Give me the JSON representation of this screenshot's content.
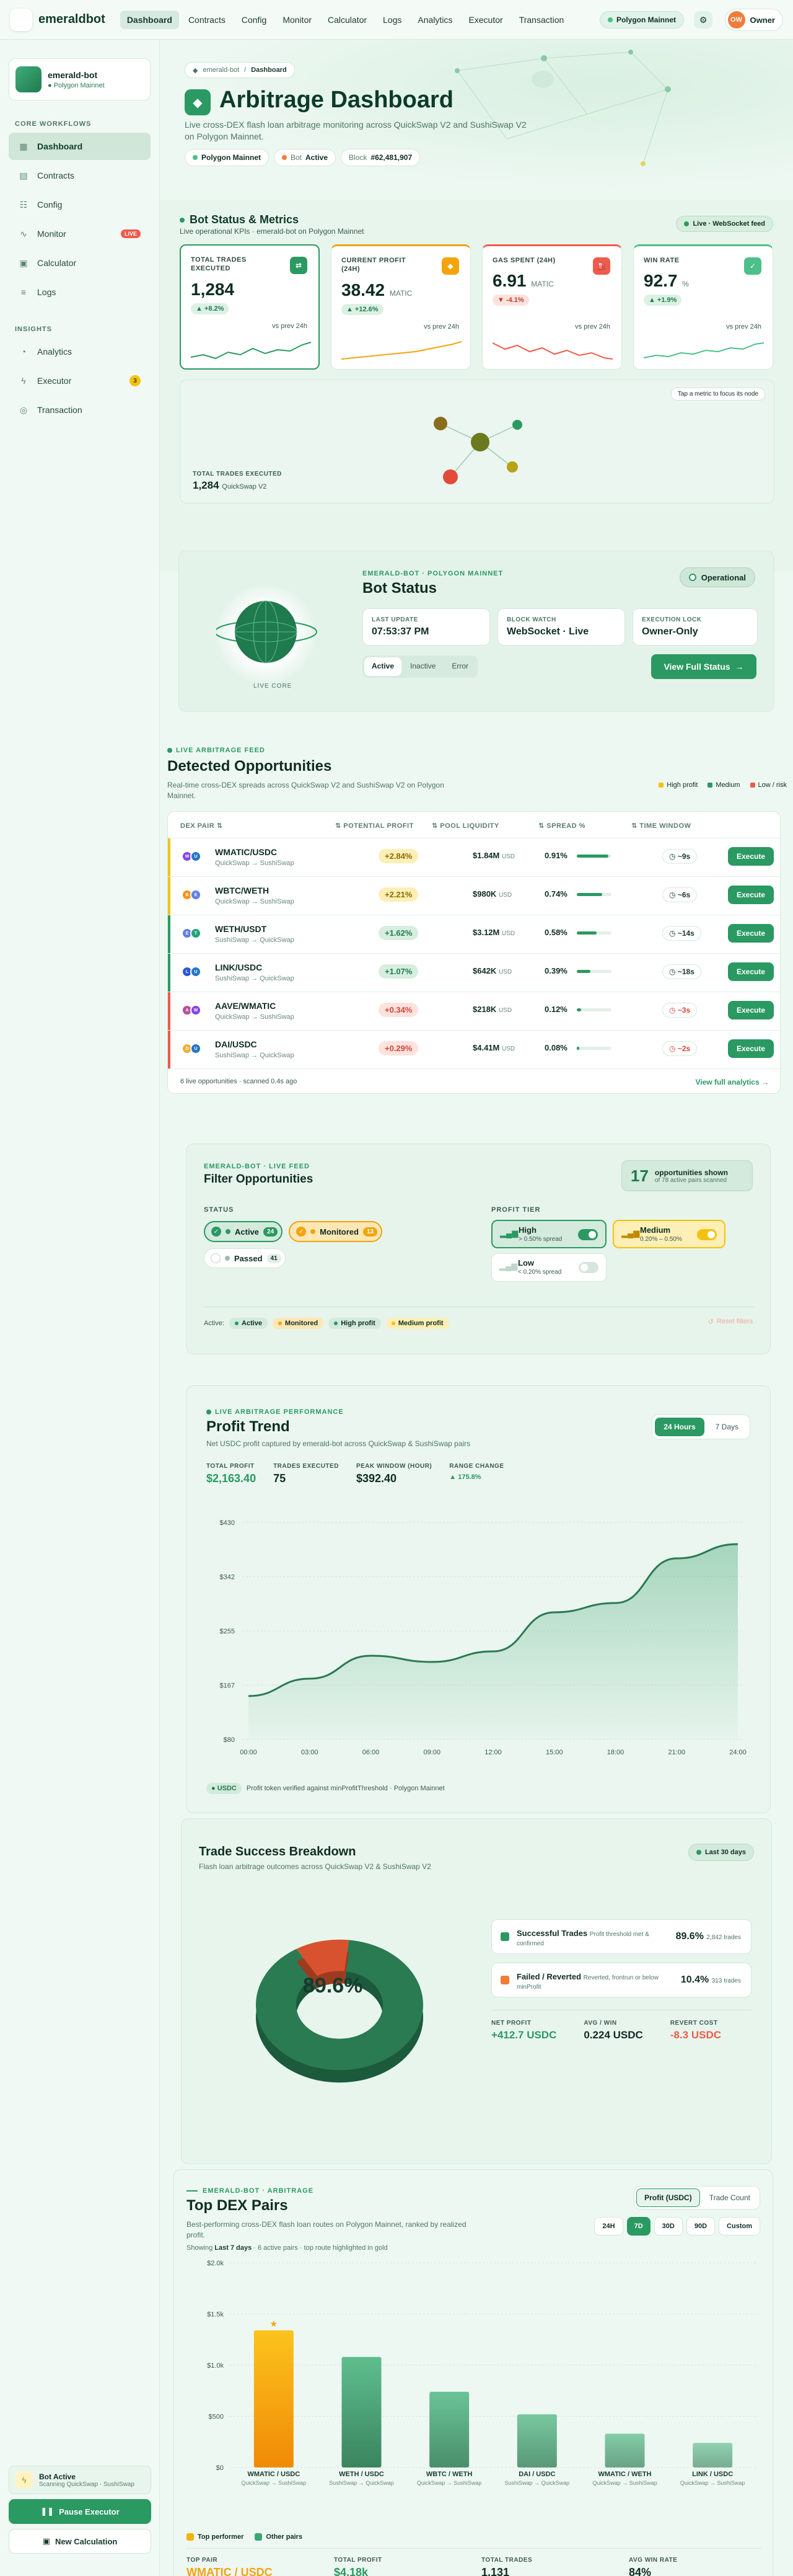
{
  "nav": {
    "brand": "emeraldbot",
    "links": [
      "Dashboard",
      "Contracts",
      "Config",
      "Monitor",
      "Calculator",
      "Logs",
      "Analytics",
      "Executor",
      "Transaction"
    ],
    "network": "Polygon Mainnet",
    "user": "Owner",
    "user_initials": "OW"
  },
  "sidebar": {
    "bot_name": "emerald-bot",
    "bot_network": "Polygon Mainnet",
    "section_core": "CORE WORKFLOWS",
    "section_insights": "INSIGHTS",
    "items": [
      {
        "label": "Dashboard",
        "icon": "grid-icon"
      },
      {
        "label": "Contracts",
        "icon": "file-icon"
      },
      {
        "label": "Config",
        "icon": "sliders-icon"
      },
      {
        "label": "Monitor",
        "icon": "activity-icon",
        "badge": "LIVE"
      },
      {
        "label": "Calculator",
        "icon": "calculator-icon"
      },
      {
        "label": "Logs",
        "icon": "list-icon"
      },
      {
        "label": "Analytics",
        "icon": "chart-icon"
      },
      {
        "label": "Executor",
        "icon": "lightning-icon",
        "badge": "3"
      },
      {
        "label": "Transaction",
        "icon": "circle-icon"
      }
    ],
    "status_title": "Bot Active",
    "status_sub": "Scanning QuickSwap · SushiSwap",
    "pause_label": "Pause Executor",
    "new_calc_label": "New Calculation"
  },
  "hero": {
    "crumb_root": "emerald-bot",
    "crumb_current": "Dashboard",
    "title": "Arbitrage Dashboard",
    "subtitle": "Live cross-DEX flash loan arbitrage monitoring across QuickSwap V2 and SushiSwap V2 on Polygon Mainnet.",
    "pill_network": "Polygon Mainnet",
    "pill_bot_label": "Bot",
    "pill_bot_value": "Active",
    "pill_block_label": "Block",
    "pill_block_value": "#62,481,907"
  },
  "metrics": {
    "title": "Bot Status & Metrics",
    "subtitle": "Live operational KPIs · emerald-bot on Polygon Mainnet",
    "live_badge": "Live · WebSocket feed",
    "cards": [
      {
        "label": "TOTAL TRADES EXECUTED",
        "value": "1,284",
        "unit": "",
        "delta": "+8.2%",
        "prev": "vs prev 24h",
        "icon": "⇄",
        "color": "#2a9962"
      },
      {
        "label": "CURRENT PROFIT (24H)",
        "value": "38.42",
        "unit": "MATIC",
        "delta": "+12.6%",
        "prev": "vs prev 24h",
        "icon": "◆",
        "color": "#f4a30d"
      },
      {
        "label": "GAS SPENT (24H)",
        "value": "6.91",
        "unit": "MATIC",
        "delta": "-4.1%",
        "prev": "vs prev 24h",
        "icon": "⛽",
        "color": "#f05a4a"
      },
      {
        "label": "WIN RATE",
        "value": "92.7",
        "unit": "%",
        "delta": "+1.9%",
        "prev": "vs prev 24h",
        "icon": "✓",
        "color": "#4cbf8a"
      }
    ],
    "network_hint": "Tap a metric to focus its node",
    "network_label": "TOTAL TRADES EXECUTED",
    "network_value": "1,284",
    "network_sub": "QuickSwap V2"
  },
  "bot_status": {
    "eyebrow": "EMERALD-BOT · POLYGON MAINNET",
    "title": "Bot Status",
    "state": "Operational",
    "globe_label": "LIVE CORE",
    "boxes": [
      {
        "label": "LAST UPDATE",
        "value": "07:53:37 PM"
      },
      {
        "label": "BLOCK WATCH",
        "value": "WebSocket · Live"
      },
      {
        "label": "EXECUTION LOCK",
        "value": "Owner-Only"
      }
    ],
    "tabs": [
      "Active",
      "Inactive",
      "Error"
    ],
    "cta": "View Full Status"
  },
  "opportunities": {
    "eyebrow": "LIVE ARBITRAGE FEED",
    "title": "Detected Opportunities",
    "subtitle": "Real-time cross-DEX spreads across QuickSwap V2 and SushiSwap V2 on Polygon Mainnet.",
    "legend": [
      {
        "label": "High profit",
        "color": "#f4c20d"
      },
      {
        "label": "Medium",
        "color": "#2a9962"
      },
      {
        "label": "Low / risk",
        "color": "#f05a4a"
      }
    ],
    "columns": [
      "DEX PAIR",
      "POTENTIAL PROFIT",
      "POOL LIQUIDITY",
      "SPREAD %",
      "TIME WINDOW"
    ],
    "rows": [
      {
        "pair": "WMATIC/USDC",
        "route": "QuickSwap → SushiSwap",
        "profit": "+2.84%",
        "liq": "$1.84M",
        "unit": "USD",
        "spread": "0.91%",
        "spread_pct": 0.91,
        "time": "~9s",
        "tier": "high",
        "c1": "#8247e5",
        "c2": "#2775ca",
        "t1": "W",
        "t2": "U"
      },
      {
        "pair": "WBTC/WETH",
        "route": "QuickSwap → SushiSwap",
        "profit": "+2.21%",
        "liq": "$980K",
        "unit": "USD",
        "spread": "0.74%",
        "spread_pct": 0.74,
        "time": "~6s",
        "tier": "high",
        "c1": "#f7931a",
        "c2": "#627eea",
        "t1": "B",
        "t2": "E"
      },
      {
        "pair": "WETH/USDT",
        "route": "SushiSwap → QuickSwap",
        "profit": "+1.62%",
        "liq": "$3.12M",
        "unit": "USD",
        "spread": "0.58%",
        "spread_pct": 0.58,
        "time": "~14s",
        "tier": "medium",
        "c1": "#627eea",
        "c2": "#26a17b",
        "t1": "E",
        "t2": "T"
      },
      {
        "pair": "LINK/USDC",
        "route": "SushiSwap → QuickSwap",
        "profit": "+1.07%",
        "liq": "$642K",
        "unit": "USD",
        "spread": "0.39%",
        "spread_pct": 0.39,
        "time": "~18s",
        "tier": "medium",
        "c1": "#2a5ada",
        "c2": "#2775ca",
        "t1": "L",
        "t2": "U"
      },
      {
        "pair": "AAVE/WMATIC",
        "route": "QuickSwap → SushiSwap",
        "profit": "+0.34%",
        "liq": "$218K",
        "unit": "USD",
        "spread": "0.12%",
        "spread_pct": 0.12,
        "time": "~3s",
        "tier": "low",
        "c1": "#b6509e",
        "c2": "#8247e5",
        "t1": "A",
        "t2": "W"
      },
      {
        "pair": "DAI/USDC",
        "route": "SushiSwap → QuickSwap",
        "profit": "+0.29%",
        "liq": "$4.41M",
        "unit": "USD",
        "spread": "0.08%",
        "spread_pct": 0.08,
        "time": "~2s",
        "tier": "low",
        "c1": "#f5ac37",
        "c2": "#2775ca",
        "t1": "D",
        "t2": "U"
      }
    ],
    "execute_label": "Execute",
    "footer_left": "6 live opportunities · scanned 0.4s ago",
    "footer_right": "View full analytics →"
  },
  "filter": {
    "eyebrow": "EMERALD-BOT · LIVE FEED",
    "title": "Filter Opportunities",
    "count": "17",
    "count_text": "opportunities shown",
    "count_sub": "of 78 active pairs scanned",
    "status_label": "STATUS",
    "status_chips": [
      {
        "label": "Active",
        "count": "24"
      },
      {
        "label": "Monitored",
        "count": "13"
      },
      {
        "label": "Passed",
        "count": "41"
      }
    ],
    "tier_label": "PROFIT TIER",
    "tiers": [
      {
        "label": "High",
        "sub": "> 0.50% spread"
      },
      {
        "label": "Medium",
        "sub": "0.20% – 0.50%"
      },
      {
        "label": "Low",
        "sub": "< 0.20% spread"
      }
    ],
    "active_label": "Active:",
    "active_tags": [
      "Active",
      "Monitored",
      "High profit",
      "Medium profit"
    ],
    "reset": "Reset filters"
  },
  "profit_trend": {
    "eyebrow": "LIVE ARBITRAGE PERFORMANCE",
    "title": "Profit Trend",
    "subtitle": "Net USDC profit captured by emerald-bot across QuickSwap & SushiSwap pairs",
    "toggle": [
      "24 Hours",
      "7 Days"
    ],
    "stats": [
      {
        "label": "TOTAL PROFIT",
        "value": "$2,163.40"
      },
      {
        "label": "TRADES EXECUTED",
        "value": "75"
      },
      {
        "label": "PEAK WINDOW (HOUR)",
        "value": "$392.40"
      },
      {
        "label": "RANGE CHANGE",
        "value": "▲ 175.8%"
      }
    ],
    "footer_chip": "USDC",
    "footer_text": "Profit token verified against minProfitThreshold · Polygon Mainnet"
  },
  "success": {
    "title": "Trade Success Breakdown",
    "subtitle": "Flash loan arbitrage outcomes across QuickSwap V2 & SushiSwap V2",
    "range": "Last 30 days",
    "center_value": "89.6%",
    "rows": [
      {
        "label": "Successful Trades",
        "desc": "Profit threshold met & confirmed",
        "pct": "89.6%",
        "count": "2,842 trades",
        "color": "#2a9962"
      },
      {
        "label": "Failed / Reverted",
        "desc": "Reverted, frontrun or below minProfit",
        "pct": "10.4%",
        "count": "313 trades",
        "color": "#f07c3a"
      }
    ],
    "stats": [
      {
        "label": "NET PROFIT",
        "value": "+412.7 USDC",
        "color": "#2a9962"
      },
      {
        "label": "AVG / WIN",
        "value": "0.224 USDC",
        "color": "#0f2d22"
      },
      {
        "label": "REVERT COST",
        "value": "-8.3 USDC",
        "color": "#f05a4a"
      }
    ]
  },
  "top_pairs": {
    "eyebrow": "EMERALD-BOT · ARBITRAGE",
    "title": "Top DEX Pairs",
    "subtitle": "Best-performing cross-DEX flash loan routes on Polygon Mainnet, ranked by realized profit.",
    "metric_toggle": [
      "Profit (USDC)",
      "Trade Count"
    ],
    "ranges": [
      "24H",
      "7D",
      "30D",
      "90D",
      "Custom"
    ],
    "showing_pre": "Showing",
    "showing_bold": "Last 7 days",
    "showing_post": "· 6 active pairs · top route highlighted in gold",
    "legend_top": "Top performer",
    "legend_other": "Other pairs",
    "footer": [
      {
        "label": "TOP PAIR",
        "value": "WMATIC / USDC",
        "color": "#f4a30d"
      },
      {
        "label": "TOTAL PROFIT",
        "value": "$4.18k",
        "color": "#2a9962"
      },
      {
        "label": "TOTAL TRADES",
        "value": "1,131",
        "color": "#0f2d22"
      },
      {
        "label": "AVG WIN RATE",
        "value": "84%",
        "color": "#0f2d22"
      }
    ]
  },
  "chart_data": [
    {
      "type": "line",
      "title": "Profit Trend",
      "x": [
        "00:00",
        "03:00",
        "06:00",
        "09:00",
        "12:00",
        "15:00",
        "18:00",
        "21:00",
        "24:00"
      ],
      "y": [
        150,
        178,
        215,
        205,
        222,
        285,
        300,
        372,
        395
      ],
      "yticks": [
        "$430",
        "$342",
        "$255",
        "$167",
        "$80"
      ],
      "ylim": [
        80,
        430
      ],
      "grid": true
    },
    {
      "type": "pie",
      "title": "Trade Success Breakdown",
      "categories": [
        "Successful Trades",
        "Failed / Reverted"
      ],
      "values": [
        89.6,
        10.4
      ]
    },
    {
      "type": "bar",
      "title": "Top DEX Pairs",
      "categories": [
        "WMATIC / USDC",
        "WETH / USDC",
        "WBTC / WETH",
        "DAI / USDC",
        "WMATIC / WETH",
        "LINK / USDC"
      ],
      "routes": [
        "QuickSwap → SushiSwap",
        "SushiSwap → QuickSwap",
        "QuickSwap → SushiSwap",
        "SushiSwap → QuickSwap",
        "QuickSwap → SushiSwap",
        "QuickSwap → SushiSwap"
      ],
      "values": [
        1340,
        1080,
        740,
        520,
        330,
        240
      ],
      "yticks": [
        "$2.0k",
        "$1.5k",
        "$1.0k",
        "$500",
        "$0"
      ],
      "ylim": [
        0,
        2000
      ],
      "highlight": 0
    }
  ]
}
